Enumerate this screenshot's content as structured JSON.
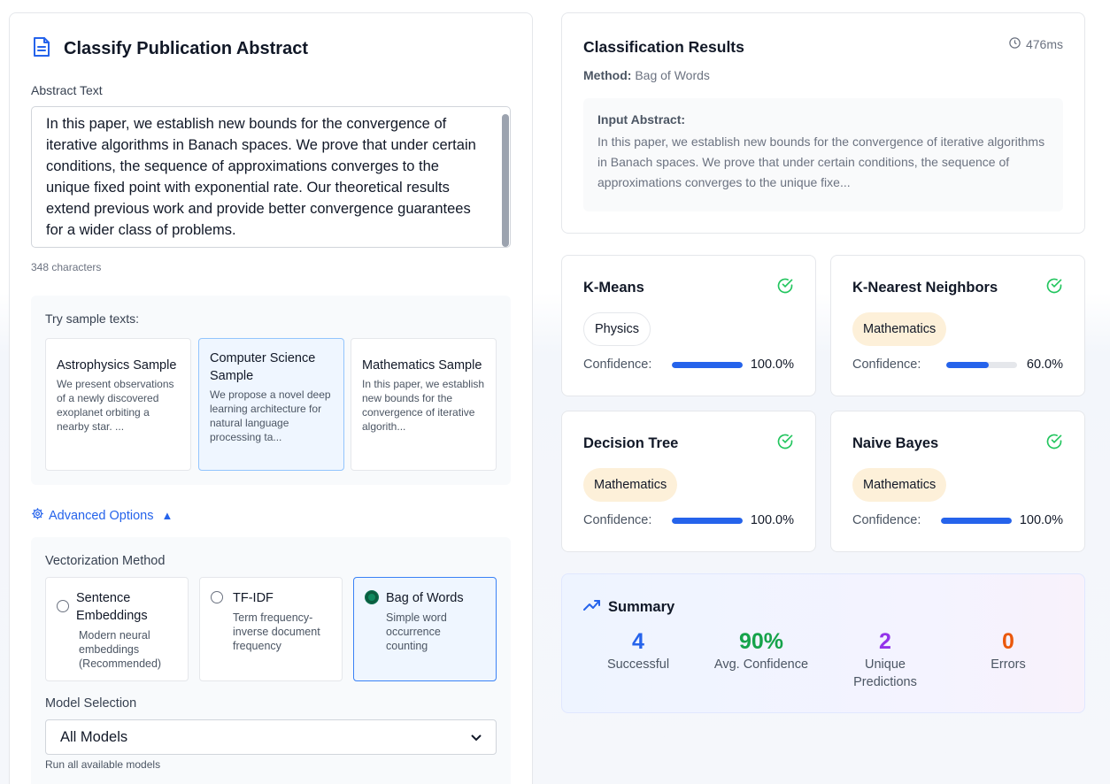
{
  "classify": {
    "title": "Classify Publication Abstract",
    "abstract_label": "Abstract Text",
    "abstract_text": "In this paper, we establish new bounds for the convergence of iterative algorithms in Banach spaces. We prove that under certain conditions, the sequence of approximations converges to the unique fixed point with exponential rate. Our theoretical results extend previous work and provide better convergence guarantees for a wider class of problems.",
    "char_count": "348 characters",
    "samples_header": "Try sample texts:",
    "samples": [
      {
        "title": "Astrophysics Sample",
        "desc": "We present observations of a newly discovered exoplanet orbiting a nearby star. ..."
      },
      {
        "title": "Computer Science Sample",
        "desc": "We propose a novel deep learning architecture for natural language processing ta..."
      },
      {
        "title": "Mathematics Sample",
        "desc": "In this paper, we establish new bounds for the convergence of iterative algorith..."
      }
    ],
    "advanced_label": "Advanced Options",
    "vectorization_label": "Vectorization Method",
    "methods": [
      {
        "title": "Sentence Embeddings",
        "desc": "Modern neural embeddings (Recommended)"
      },
      {
        "title": "TF-IDF",
        "desc": "Term frequency-inverse document frequency"
      },
      {
        "title": "Bag of Words",
        "desc": "Simple word occurrence counting",
        "selected": true
      }
    ],
    "model_selection_label": "Model Selection",
    "model_selection_value": "All Models",
    "model_selection_hint": "Run all available models"
  },
  "results": {
    "title": "Classification Results",
    "time": "476ms",
    "method_label": "Method:",
    "method_value": "Bag of Words",
    "input_header": "Input Abstract:",
    "input_text": "In this paper, we establish new bounds for the convergence of iterative algorithms in Banach spaces. We prove that under certain conditions, the sequence of approximations converges to the unique fixe..."
  },
  "models": [
    {
      "name": "K-Means",
      "prediction": "Physics",
      "confidence_label": "Confidence:",
      "confidence": 1.0,
      "confidence_text": "100.0%"
    },
    {
      "name": "K-Nearest Neighbors",
      "prediction": "Mathematics",
      "confidence_label": "Confidence:",
      "confidence": 0.6,
      "confidence_text": "60.0%"
    },
    {
      "name": "Decision Tree",
      "prediction": "Mathematics",
      "confidence_label": "Confidence:",
      "confidence": 1.0,
      "confidence_text": "100.0%"
    },
    {
      "name": "Naive Bayes",
      "prediction": "Mathematics",
      "confidence_label": "Confidence:",
      "confidence": 1.0,
      "confidence_text": "100.0%"
    }
  ],
  "summary": {
    "title": "Summary",
    "stats": [
      {
        "value": "4",
        "label": "Successful",
        "color": "#2563eb"
      },
      {
        "value": "90%",
        "label": "Avg. Confidence",
        "color": "#16a34a"
      },
      {
        "value": "2",
        "label": "Unique Predictions",
        "color": "#9333ea"
      },
      {
        "value": "0",
        "label": "Errors",
        "color": "#ea580c"
      }
    ]
  },
  "colors": {
    "accent": "#2563eb",
    "success": "#22c55e",
    "chip_math": "#fdf0d9"
  }
}
